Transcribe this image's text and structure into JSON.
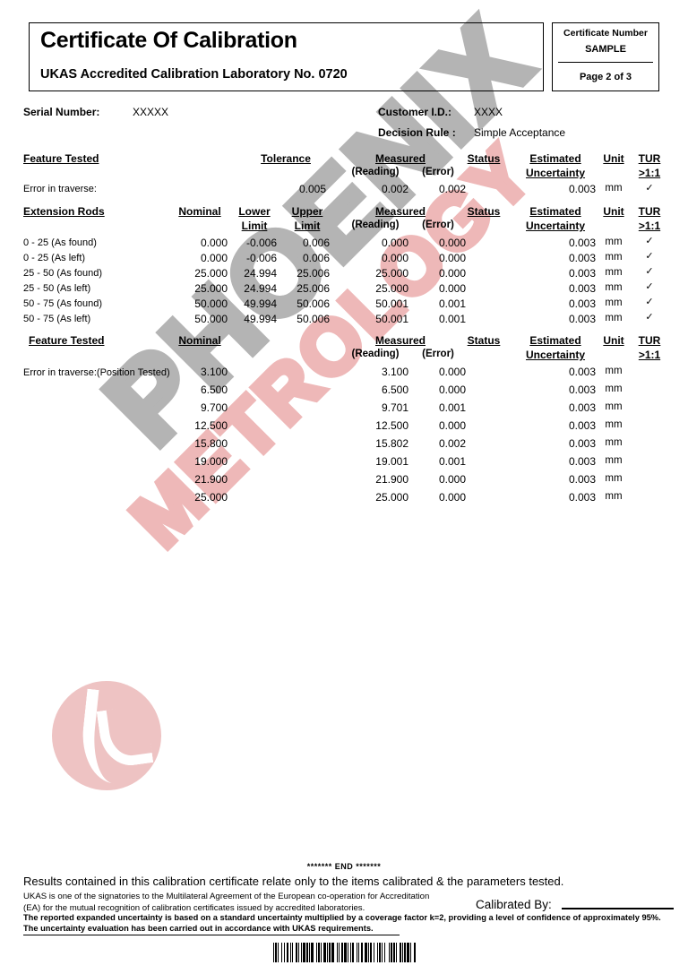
{
  "header": {
    "title": "Certificate Of Calibration",
    "subtitle": "UKAS Accredited Calibration Laboratory No. 0720",
    "certificate_number_label": "Certificate Number",
    "certificate_number_value": "SAMPLE",
    "page_label": "Page 2 of 3"
  },
  "info": {
    "serial_number_label": "Serial Number:",
    "serial_number_value": "XXXXX",
    "customer_id_label": "Customer I.D.:",
    "customer_id_value": "XXXX",
    "decision_rule_label": "Decision Rule :",
    "decision_rule_value": "Simple Acceptance"
  },
  "table1": {
    "headers": {
      "feature": "Feature Tested",
      "tolerance": "Tolerance",
      "measured": "Measured",
      "reading": "(Reading)",
      "error": "(Error)",
      "status": "Status",
      "estimated": "Estimated",
      "uncertainty": "Uncertainty",
      "unit": "Unit",
      "tur": "TUR",
      "tur_ratio": ">1:1"
    },
    "rows": [
      {
        "feature": "Error in traverse:",
        "tolerance": "0.005",
        "reading": "0.002",
        "error": "0.002",
        "status": "",
        "uncertainty": "0.003",
        "unit": "mm",
        "tur": "✓"
      }
    ]
  },
  "table2": {
    "headers": {
      "feature": "Extension Rods",
      "nominal": "Nominal",
      "lower": "Lower",
      "lower2": "Limit",
      "upper": "Upper",
      "upper2": "Limit",
      "measured": "Measured",
      "reading": "(Reading)",
      "error": "(Error)",
      "status": "Status",
      "estimated": "Estimated",
      "uncertainty": "Uncertainty",
      "unit": "Unit",
      "tur": "TUR",
      "tur_ratio": ">1:1"
    },
    "rows": [
      {
        "feature": "0 - 25 (As found)",
        "nominal": "0.000",
        "lower": "-0.006",
        "upper": "0.006",
        "reading": "0.000",
        "error": "0.000",
        "status": "",
        "uncertainty": "0.003",
        "unit": "mm",
        "tur": "✓"
      },
      {
        "feature": "0 - 25 (As left)",
        "nominal": "0.000",
        "lower": "-0.006",
        "upper": "0.006",
        "reading": "0.000",
        "error": "0.000",
        "status": "",
        "uncertainty": "0.003",
        "unit": "mm",
        "tur": "✓"
      },
      {
        "feature": "25 - 50 (As found)",
        "nominal": "25.000",
        "lower": "24.994",
        "upper": "25.006",
        "reading": "25.000",
        "error": "0.000",
        "status": "",
        "uncertainty": "0.003",
        "unit": "mm",
        "tur": "✓"
      },
      {
        "feature": "25 - 50 (As left)",
        "nominal": "25.000",
        "lower": "24.994",
        "upper": "25.006",
        "reading": "25.000",
        "error": "0.000",
        "status": "",
        "uncertainty": "0.003",
        "unit": "mm",
        "tur": "✓"
      },
      {
        "feature": "50 - 75 (As found)",
        "nominal": "50.000",
        "lower": "49.994",
        "upper": "50.006",
        "reading": "50.001",
        "error": "0.001",
        "status": "",
        "uncertainty": "0.003",
        "unit": "mm",
        "tur": "✓"
      },
      {
        "feature": "50 - 75 (As left)",
        "nominal": "50.000",
        "lower": "49.994",
        "upper": "50.006",
        "reading": "50.001",
        "error": "0.001",
        "status": "",
        "uncertainty": "0.003",
        "unit": "mm",
        "tur": "✓"
      }
    ]
  },
  "table3": {
    "headers": {
      "feature": "Feature Tested",
      "nominal": "Nominal",
      "measured": "Measured",
      "reading": "(Reading)",
      "error": "(Error)",
      "status": "Status",
      "estimated": "Estimated",
      "uncertainty": "Uncertainty",
      "unit": "Unit",
      "tur": "TUR",
      "tur_ratio": ">1:1"
    },
    "row_label": "Error in traverse:(Position Tested)",
    "rows": [
      {
        "nominal": "3.100",
        "reading": "3.100",
        "error": "0.000",
        "status": "",
        "uncertainty": "0.003",
        "unit": "mm"
      },
      {
        "nominal": "6.500",
        "reading": "6.500",
        "error": "0.000",
        "status": "",
        "uncertainty": "0.003",
        "unit": "mm"
      },
      {
        "nominal": "9.700",
        "reading": "9.701",
        "error": "0.001",
        "status": "",
        "uncertainty": "0.003",
        "unit": "mm"
      },
      {
        "nominal": "12.500",
        "reading": "12.500",
        "error": "0.000",
        "status": "",
        "uncertainty": "0.003",
        "unit": "mm"
      },
      {
        "nominal": "15.800",
        "reading": "15.802",
        "error": "0.002",
        "status": "",
        "uncertainty": "0.003",
        "unit": "mm"
      },
      {
        "nominal": "19.000",
        "reading": "19.001",
        "error": "0.001",
        "status": "",
        "uncertainty": "0.003",
        "unit": "mm"
      },
      {
        "nominal": "21.900",
        "reading": "21.900",
        "error": "0.000",
        "status": "",
        "uncertainty": "0.003",
        "unit": "mm"
      },
      {
        "nominal": "25.000",
        "reading": "25.000",
        "error": "0.000",
        "status": "",
        "uncertainty": "0.003",
        "unit": "mm"
      }
    ]
  },
  "footer": {
    "end_marker": "******* END *******",
    "line1": "Results contained in this calibration certificate relate only to the items calibrated & the parameters tested.",
    "line2": "UKAS is one of the signatories to the Multilateral Agreement of the European co-operation for Accreditation",
    "line3": "(EA) for the mutual recognition of calibration certificates issued by accredited laboratories.",
    "line4": "The reported expanded uncertainty is based on a standard uncertainty multiplied by a coverage factor k=2, providing a level  of confidence of approximately 95%.",
    "line5": "The uncertainty evaluation has been carried out in accordance with UKAS requirements.",
    "calibrated_by_label": "Calibrated By:"
  },
  "watermark": {
    "line1": "PHOENIX",
    "line2": "METROLOGY",
    "color_gray": "#b4b4b4",
    "color_pink": "#eeb8b8"
  }
}
